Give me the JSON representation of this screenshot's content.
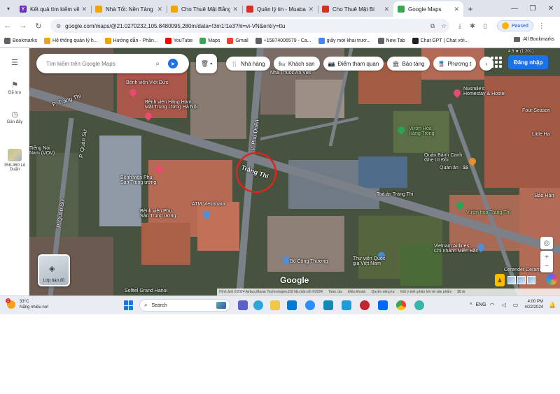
{
  "browser": {
    "tabs": [
      {
        "title": "Kết quả tìm kiếm về",
        "favicon_color": "#6b2fb8",
        "favicon_text": "Y",
        "active": false
      },
      {
        "title": "Nhà Tốt: Nền Tảng M",
        "favicon_color": "#f0a500",
        "favicon_text": "",
        "active": false
      },
      {
        "title": "Cho Thuê Mặt Bằng",
        "favicon_color": "#f0a500",
        "favicon_text": "",
        "active": false
      },
      {
        "title": "Quản lý tin - Muaba",
        "favicon_color": "#d93025",
        "favicon_text": "",
        "active": false
      },
      {
        "title": "Cho Thuê Mặt Bi",
        "favicon_color": "#d93025",
        "favicon_text": "",
        "active": false
      },
      {
        "title": "Google Maps",
        "favicon_color": "#34a853",
        "favicon_text": "",
        "active": true
      }
    ],
    "url": "google.com/maps/@21.0270232,105.8480095,280m/data=!3m1!1e3?hl=vi-VN&entry=ttu",
    "profile_label": "Paused",
    "bookmarks": [
      {
        "label": "Bookmarks",
        "color": "#5f6368"
      },
      {
        "label": "Hệ thống quản lý h...",
        "color": "#f0a500"
      },
      {
        "label": "Hướng dẫn - Phần...",
        "color": "#f0a500"
      },
      {
        "label": "YouTube",
        "color": "#ff0000"
      },
      {
        "label": "Maps",
        "color": "#34a853"
      },
      {
        "label": "Gmail",
        "color": "#ea4335"
      },
      {
        "label": "+15874006579 - Ca...",
        "color": "#5f6368"
      },
      {
        "label": "giấy mời khai trươ...",
        "color": "#4285f4"
      },
      {
        "label": "New Tab",
        "color": "#5f6368"
      },
      {
        "label": "Chat GPT | Chat với...",
        "color": "#202124"
      }
    ],
    "all_bookmarks": "All Bookmarks"
  },
  "maps": {
    "search_placeholder": "Tìm kiếm trên Google Maps",
    "chips": [
      {
        "label": "Nhà hàng",
        "icon": "fork-knife-icon"
      },
      {
        "label": "Khách sạn",
        "icon": "bed-icon"
      },
      {
        "label": "Điểm tham quan",
        "icon": "camera-icon"
      },
      {
        "label": "Bảo tàng",
        "icon": "museum-icon"
      },
      {
        "label": "Phương t",
        "icon": "transit-icon"
      }
    ],
    "sign_in": "Đăng nhập",
    "rail": {
      "menu": "",
      "saved": "Đã lưu",
      "recent": "Gần đây",
      "place": "358-360 Lê Duẩn"
    },
    "labels": {
      "p_trang_thi_left": "P. Tràng Thi",
      "p_phu_doan": "P. Phủ Doãn",
      "trang_thi_main": "Tràng Thi",
      "p_quan_su_1": "P. Quán Sứ",
      "p_quan_su_2": "P. Quán Sứ",
      "viet_duc": "Bệnh viện Việt Đức",
      "viet_duc_sub": "Bệnh viện Hàng Hàm\nMặt Trung Ương Hà Nội",
      "tieng_noi": "Tiếng Nói\nNam (VOV)",
      "vien_phu": "Bệnh viện Phụ\nSản Trung ương",
      "vien_phu_top": "Bệnh viện Phụ\nSản Trung ương",
      "atm": "ATM Vietinbank",
      "nha_thuoc": "Nhà Thuốc An Viet",
      "nusmile": "Nusmile's\nHomestay & Hostel",
      "vuon_hoa_hang_trong": "Vườn Hoa\nHàng Trống",
      "quan_banh_canh": "Quán Bánh Canh\nGhẹ Út Đồi",
      "quan_banh_sub": "Quán ăn · $$",
      "toa_an": "Toà án Tràng Thi",
      "vuon_hoa_trang_thi": "Vườn hoa Tràng Thi",
      "bo_cong_thuong": "Bộ Công Thương",
      "thu_vien": "Thư viện Quốc\ngia Việt Nam",
      "vietnam_airlines": "Vietnam Airlines\nChi nhánh Miền Bắc",
      "cerender": "Cerender Ceramics",
      "sofitel": "Sofitel Grand Hanoi",
      "four_season": "Four Season",
      "little_hanoi": "Little Ha",
      "bao_han": "Bảo Hân",
      "top_right": "4.5 ★ (1.201)"
    },
    "layers_label": "Lớp bản đồ",
    "google_logo": "Google",
    "attribution": [
      "Hình ảnh ©2024 Airbus,Maxar Technologies,Dữ liệu bản đồ ©2024",
      "Toàn cầu",
      "Điều khoản",
      "Quyền riêng tư",
      "Gửi ý kiến phản hồi về sản phẩm"
    ],
    "scale": "50 m"
  },
  "taskbar": {
    "weather_temp": "33°C",
    "weather_desc": "Nắng nhiều nơi",
    "weather_badge": "1",
    "search_label": "Search",
    "lang": "ENG",
    "time": "4:00 PM",
    "date": "4/22/2024"
  }
}
